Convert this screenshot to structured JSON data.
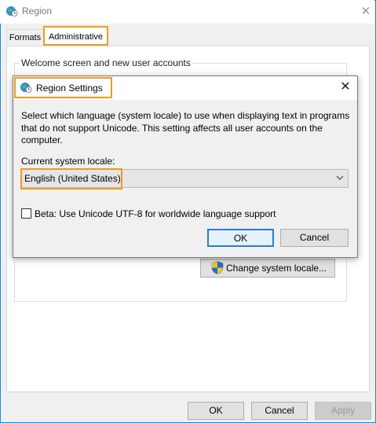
{
  "region_window": {
    "title": "Region",
    "close_glyph": "✕",
    "tabs": [
      {
        "label": "Formats"
      },
      {
        "label": "Administrative"
      }
    ],
    "welcome_group_label": "Welcome screen and new user accounts",
    "change_locale_button": "Change system locale...",
    "buttons": {
      "ok": "OK",
      "cancel": "Cancel",
      "apply": "Apply"
    }
  },
  "region_settings_dialog": {
    "title": "Region Settings",
    "close_glyph": "✕",
    "description": "Select which language (system locale) to use when displaying text in programs that do not support Unicode. This setting affects all user accounts on the computer.",
    "current_locale_label": "Current system locale:",
    "current_locale_value": "English (United States)",
    "beta_checkbox_label": "Beta: Use Unicode UTF-8 for worldwide language support",
    "beta_checked": false,
    "buttons": {
      "ok": "OK",
      "cancel": "Cancel"
    }
  },
  "icons": {
    "window_icon": "globe-clock-icon",
    "shield_icon": "uac-shield-icon",
    "dropdown_icon": "chevron-down-icon"
  },
  "colors": {
    "highlight": "#f29a1c",
    "window_border": "#1a8ad4",
    "default_button_border": "#2a7ed3"
  }
}
